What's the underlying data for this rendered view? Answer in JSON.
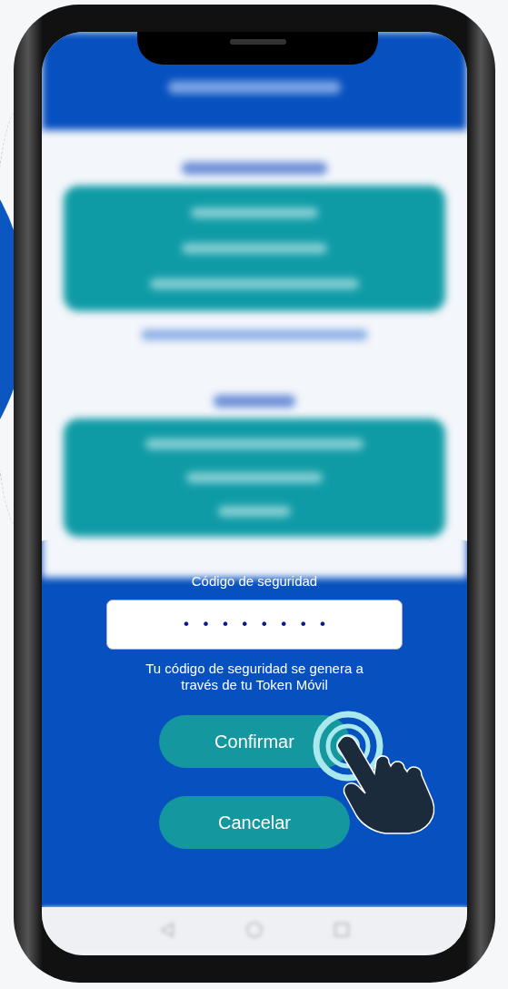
{
  "security_code": {
    "label": "Código de seguridad",
    "value": "••••••••",
    "hint": "Tu código de seguridad se genera a través de tu Token Móvil"
  },
  "buttons": [
    {
      "label": "Confirmar"
    },
    {
      "label": "Cancelar"
    }
  ]
}
